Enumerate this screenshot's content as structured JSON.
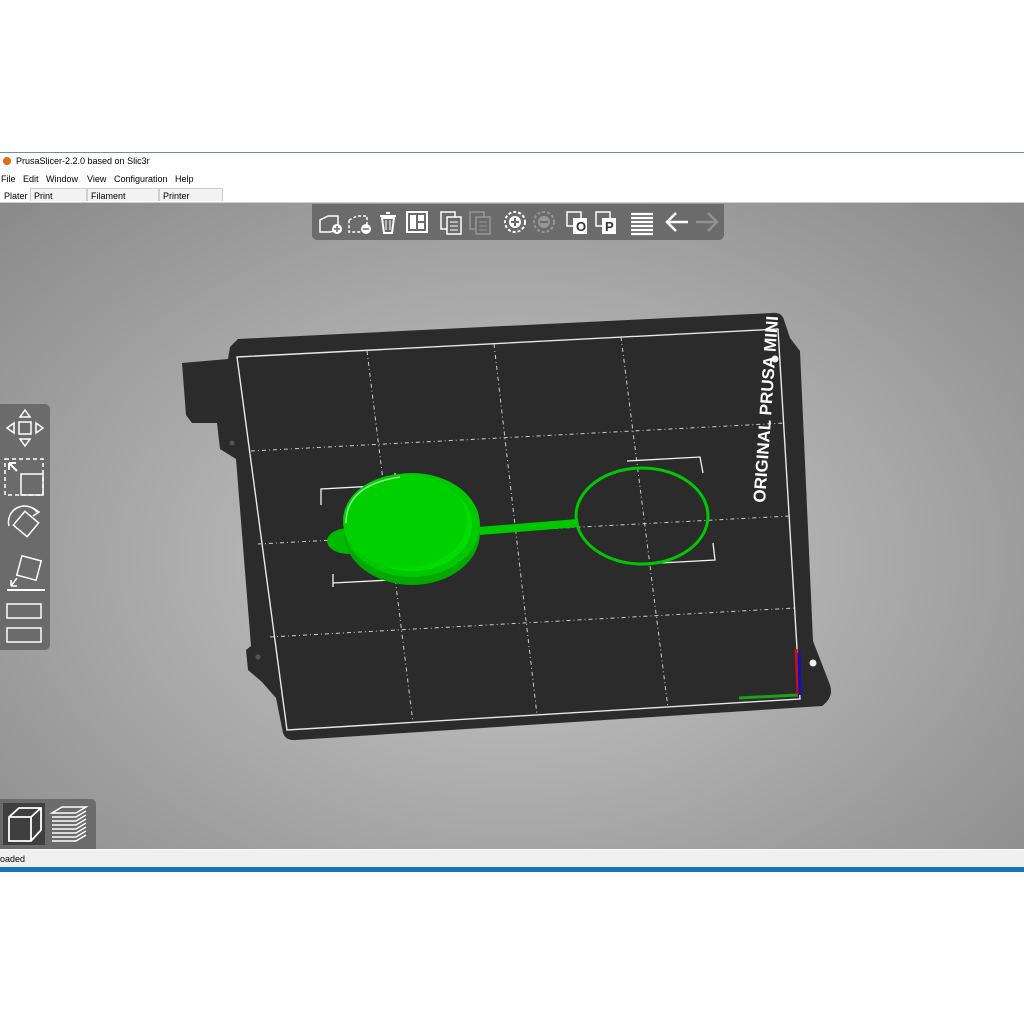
{
  "window": {
    "title": "PrusaSlicer-2.2.0 based on Slic3r"
  },
  "menu": {
    "items": [
      "File",
      "Edit",
      "Window",
      "View",
      "Configuration",
      "Help"
    ]
  },
  "tabs": [
    "Plater",
    "Print Settings",
    "Filament Settings",
    "Printer Settings"
  ],
  "top_toolbar": {
    "icons": [
      "add-icon",
      "delete-icon",
      "delete-all-icon",
      "arrange-icon",
      "copy-icon",
      "paste-icon",
      "add-instance-icon",
      "remove-instance-icon",
      "split-objects-icon",
      "split-parts-icon",
      "layers-editing-icon",
      "undo-icon",
      "redo-icon"
    ]
  },
  "left_toolbar": {
    "icons": [
      "move-icon",
      "scale-icon",
      "rotate-icon",
      "place-on-face-icon",
      "cut-icon",
      "sla-support-icon"
    ]
  },
  "view_toolbar": {
    "icons": [
      "3d-view-icon",
      "preview-icon"
    ],
    "selected": "3d-view-icon"
  },
  "bed": {
    "label": "ORIGINAL PRUSA MINI"
  },
  "colors": {
    "object": "#00d300",
    "bed": "#2d2d2d",
    "toolbar": "#6b6b6b",
    "accent": "#1a73b8"
  },
  "status": {
    "text": "oaded"
  }
}
